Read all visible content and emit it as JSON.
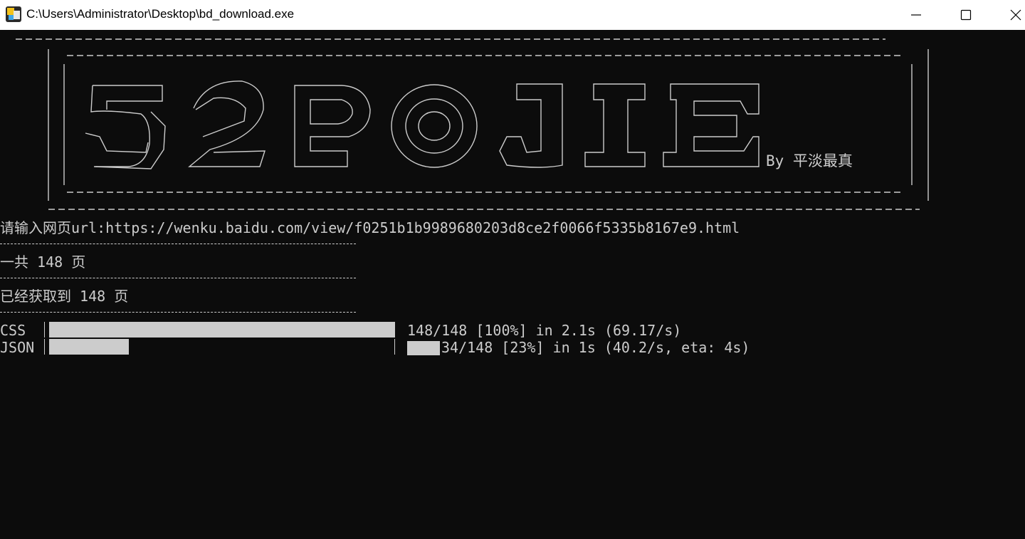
{
  "window": {
    "title": "C:\\Users\\Administrator\\Desktop\\bd_download.exe",
    "icon": "app-icon",
    "controls": [
      "minimize-icon",
      "maximize-icon",
      "close-icon"
    ]
  },
  "banner": {
    "art_text": "52POJIE",
    "byline": "By 平淡最真"
  },
  "console": {
    "prompt_line": "请输入网页url:https://wenku.baidu.com/view/f0251b1b9989680203d8ce2f0066f5335b8167e9.html",
    "total_pages": "一共 148 页",
    "fetched_pages": "已经获取到 148 页"
  },
  "progress": [
    {
      "label": "CSS",
      "fraction": 1.0,
      "info": "148/148 [100%] in 2.1s (69.17/s)"
    },
    {
      "label": "JSON",
      "fraction": 0.23,
      "info": "34/148 [23%] in 1s (40.2/s, eta: 4s)"
    }
  ],
  "colors": {
    "console_bg": "#0c0c0c",
    "console_fg": "#cccccc",
    "titlebar_bg": "#ffffff"
  }
}
